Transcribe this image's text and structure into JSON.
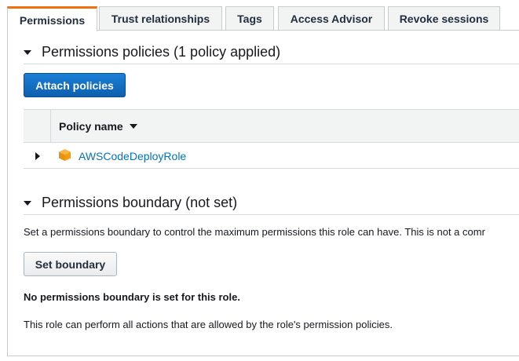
{
  "tabs": [
    {
      "label": "Permissions",
      "active": true
    },
    {
      "label": "Trust relationships",
      "active": false
    },
    {
      "label": "Tags",
      "active": false
    },
    {
      "label": "Access Advisor",
      "active": false
    },
    {
      "label": "Revoke sessions",
      "active": false
    }
  ],
  "policies_section": {
    "title": "Permissions policies (1 policy applied)",
    "attach_label": "Attach policies",
    "table": {
      "column_header": "Policy name",
      "rows": [
        {
          "name": "AWSCodeDeployRole",
          "icon": "cube-icon"
        }
      ]
    }
  },
  "boundary_section": {
    "title": "Permissions boundary (not set)",
    "description": "Set a permissions boundary to control the maximum permissions this role can have. This is not a comr",
    "set_label": "Set boundary",
    "status_bold": "No permissions boundary is set for this role.",
    "status_info": "This role can perform all actions that are allowed by the role's permission policies."
  },
  "colors": {
    "accent": "#ec7211",
    "primary_button": "#0e5fae",
    "link": "#0073bb",
    "icon": "#f39c12"
  }
}
